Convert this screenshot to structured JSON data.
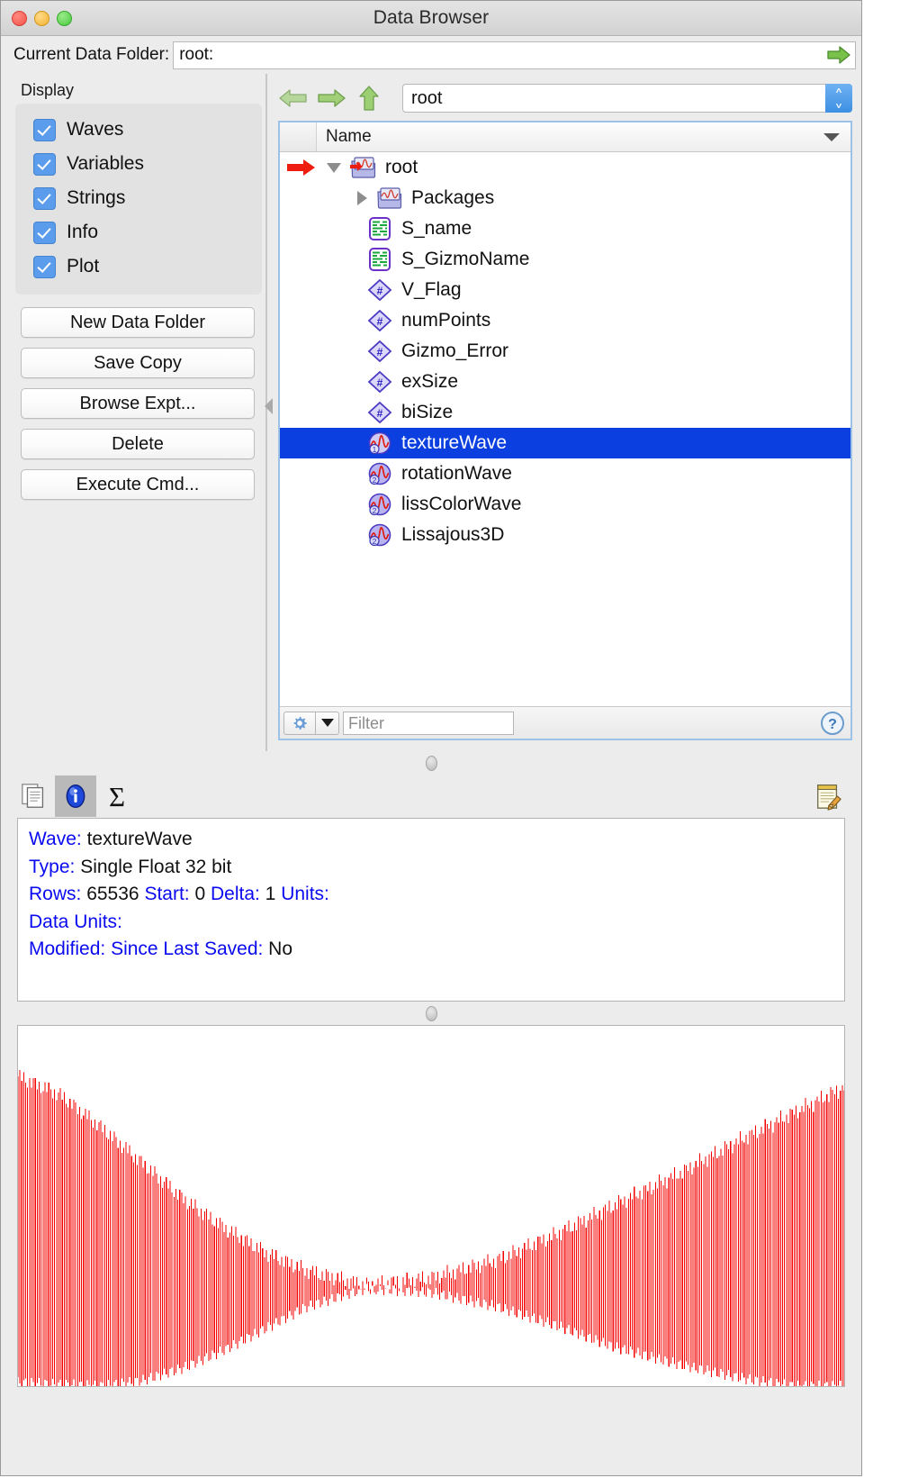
{
  "window": {
    "title": "Data Browser",
    "traffic_lights": [
      "close-button",
      "minimize-button",
      "zoom-button"
    ]
  },
  "current_folder": {
    "label": "Current Data Folder:",
    "value": "root:",
    "go_icon": "green-right-arrow-icon"
  },
  "display": {
    "group_label": "Display",
    "checkboxes": [
      {
        "label": "Waves",
        "checked": true
      },
      {
        "label": "Variables",
        "checked": true
      },
      {
        "label": "Strings",
        "checked": true
      },
      {
        "label": "Info",
        "checked": true
      },
      {
        "label": "Plot",
        "checked": true
      }
    ]
  },
  "buttons": [
    {
      "label": "New Data Folder"
    },
    {
      "label": "Save Copy"
    },
    {
      "label": "Browse Expt..."
    },
    {
      "label": "Delete"
    },
    {
      "label": "Execute Cmd..."
    }
  ],
  "navigation": {
    "back_icon": "back-arrow-icon",
    "forward_icon": "forward-arrow-icon",
    "up_icon": "up-arrow-icon",
    "path_value": "root",
    "stepper_icon": "stepper-updown-icon"
  },
  "tree": {
    "column_header": "Name",
    "sort_indicator": "sort-descending-caret-icon",
    "rows": [
      {
        "label": "root",
        "icon": "data-folder-current-icon",
        "kind": "folder",
        "indent": 0,
        "disclosure": "open",
        "selected": false,
        "cdf_marker": true
      },
      {
        "label": "Packages",
        "icon": "data-folder-icon",
        "kind": "folder",
        "indent": 1,
        "disclosure": "closed",
        "selected": false,
        "cdf_marker": false
      },
      {
        "label": "S_name",
        "icon": "string-icon",
        "kind": "string",
        "indent": 1,
        "disclosure": "none",
        "selected": false,
        "cdf_marker": false
      },
      {
        "label": "S_GizmoName",
        "icon": "string-icon",
        "kind": "string",
        "indent": 1,
        "disclosure": "none",
        "selected": false,
        "cdf_marker": false
      },
      {
        "label": "V_Flag",
        "icon": "variable-icon",
        "kind": "variable",
        "indent": 1,
        "disclosure": "none",
        "selected": false,
        "cdf_marker": false
      },
      {
        "label": "numPoints",
        "icon": "variable-icon",
        "kind": "variable",
        "indent": 1,
        "disclosure": "none",
        "selected": false,
        "cdf_marker": false
      },
      {
        "label": "Gizmo_Error",
        "icon": "variable-icon",
        "kind": "variable",
        "indent": 1,
        "disclosure": "none",
        "selected": false,
        "cdf_marker": false
      },
      {
        "label": "exSize",
        "icon": "variable-icon",
        "kind": "variable",
        "indent": 1,
        "disclosure": "none",
        "selected": false,
        "cdf_marker": false
      },
      {
        "label": "biSize",
        "icon": "variable-icon",
        "kind": "variable",
        "indent": 1,
        "disclosure": "none",
        "selected": false,
        "cdf_marker": false
      },
      {
        "label": "textureWave",
        "icon": "wave-1d-icon",
        "kind": "wave",
        "indent": 1,
        "disclosure": "none",
        "selected": true,
        "cdf_marker": false,
        "dims": "1"
      },
      {
        "label": "rotationWave",
        "icon": "wave-2d-icon",
        "kind": "wave",
        "indent": 1,
        "disclosure": "none",
        "selected": false,
        "cdf_marker": false,
        "dims": "2"
      },
      {
        "label": "lissColorWave",
        "icon": "wave-2d-icon",
        "kind": "wave",
        "indent": 1,
        "disclosure": "none",
        "selected": false,
        "cdf_marker": false,
        "dims": "2"
      },
      {
        "label": "Lissajous3D",
        "icon": "wave-2d-icon",
        "kind": "wave",
        "indent": 1,
        "disclosure": "none",
        "selected": false,
        "cdf_marker": false,
        "dims": "2"
      }
    ]
  },
  "filter": {
    "gear_icon": "gear-icon",
    "menu_icon": "chevron-down-icon",
    "placeholder": "Filter",
    "value": "",
    "help_icon": "help-question-icon"
  },
  "info_panel": {
    "tabs": [
      {
        "name": "copy-pages-tab",
        "icon": "pages-icon",
        "active": false
      },
      {
        "name": "info-tab",
        "icon": "info-circle-icon",
        "active": true
      },
      {
        "name": "statistics-tab",
        "icon": "sigma-icon",
        "active": false
      }
    ],
    "edit_icon": "notepad-pencil-icon",
    "lines": [
      {
        "parts": [
          {
            "text": "Wave:",
            "style": "key"
          },
          {
            "text": " textureWave",
            "style": "val"
          }
        ]
      },
      {
        "parts": [
          {
            "text": "Type:",
            "style": "key"
          },
          {
            "text": " Single Float 32 bit",
            "style": "val"
          }
        ]
      },
      {
        "parts": [
          {
            "text": "Rows:",
            "style": "key"
          },
          {
            "text": " 65536  ",
            "style": "val"
          },
          {
            "text": "Start:",
            "style": "key"
          },
          {
            "text": " 0  ",
            "style": "val"
          },
          {
            "text": "Delta:",
            "style": "key"
          },
          {
            "text": " 1  ",
            "style": "val"
          },
          {
            "text": "Units:",
            "style": "key"
          }
        ]
      },
      {
        "parts": [
          {
            "text": "Data Units:",
            "style": "key"
          }
        ]
      },
      {
        "parts": [
          {
            "text": "Modified:",
            "style": "key"
          },
          {
            "text": "  ",
            "style": "val"
          },
          {
            "text": "Since Last Saved:",
            "style": "key"
          },
          {
            "text": " No",
            "style": "val"
          }
        ]
      }
    ]
  },
  "chart_data": {
    "type": "line",
    "title": "",
    "xlabel": "",
    "ylabel": "",
    "series_name": "textureWave",
    "color": "#f40000",
    "grid": false,
    "legend": "none",
    "x_range": [
      0,
      65536
    ],
    "y_range": [
      -1,
      1
    ],
    "description": "Dense high-frequency oscillation whose amplitude envelope rises from the left edge, peaks around 42% of the horizontal span, then falls back toward the right edge.",
    "envelope_points": [
      {
        "x": 0.0,
        "upper": 0.72,
        "lower": -0.98
      },
      {
        "x": 0.05,
        "upper": 0.62,
        "lower": -0.99
      },
      {
        "x": 0.1,
        "upper": 0.44,
        "lower": -1.0
      },
      {
        "x": 0.15,
        "upper": 0.24,
        "lower": -0.97
      },
      {
        "x": 0.2,
        "upper": 0.04,
        "lower": -0.9
      },
      {
        "x": 0.25,
        "upper": -0.12,
        "lower": -0.8
      },
      {
        "x": 0.3,
        "upper": -0.26,
        "lower": -0.68
      },
      {
        "x": 0.35,
        "upper": -0.36,
        "lower": -0.56
      },
      {
        "x": 0.42,
        "upper": -0.44,
        "lower": -0.46
      },
      {
        "x": 0.5,
        "upper": -0.4,
        "lower": -0.48
      },
      {
        "x": 0.58,
        "upper": -0.3,
        "lower": -0.56
      },
      {
        "x": 0.65,
        "upper": -0.16,
        "lower": -0.66
      },
      {
        "x": 0.72,
        "upper": 0.0,
        "lower": -0.78
      },
      {
        "x": 0.8,
        "upper": 0.18,
        "lower": -0.88
      },
      {
        "x": 0.88,
        "upper": 0.38,
        "lower": -0.96
      },
      {
        "x": 0.94,
        "upper": 0.52,
        "lower": -1.0
      },
      {
        "x": 1.0,
        "upper": 0.66,
        "lower": -1.0
      }
    ]
  },
  "colors": {
    "selection": "#0b3fe0",
    "info_key": "#0a0af0",
    "plot_trace": "#f40000",
    "window_chrome": "#ececec",
    "tree_border": "#9cc2e8"
  }
}
